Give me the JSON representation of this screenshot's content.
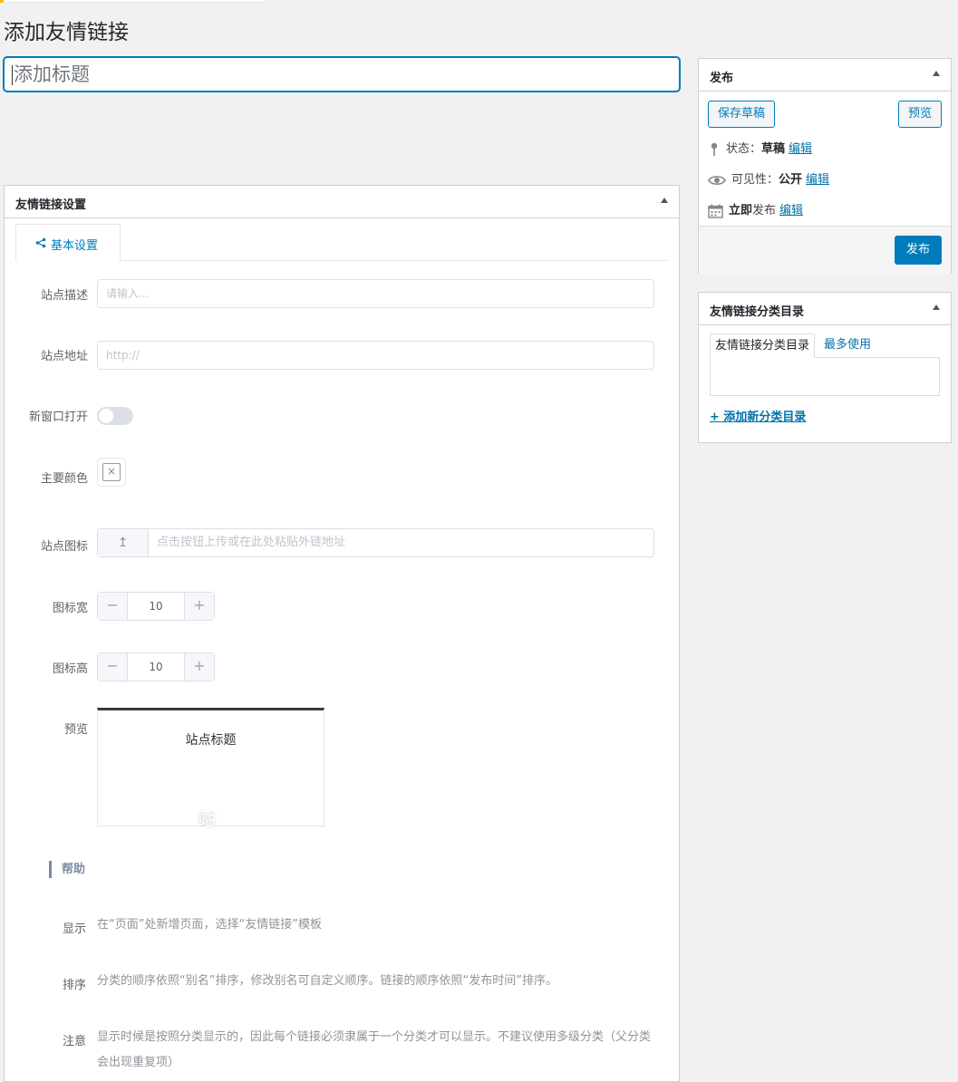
{
  "page": {
    "title": "添加友情链接",
    "title_placeholder": "添加标题"
  },
  "metabox": {
    "title": "友情链接设置",
    "tab_label": "基本设置",
    "fields": {
      "description_label": "站点描述",
      "description_placeholder": "请输入...",
      "url_label": "站点地址",
      "url_placeholder": "http://",
      "new_window_label": "新窗口打开",
      "new_window_on": false,
      "color_label": "主要颜色",
      "icon_label": "站点图标",
      "icon_placeholder": "点击按钮上传或在此处粘贴外链地址",
      "icon_width_label": "图标宽",
      "icon_width_value": "10",
      "icon_height_label": "图标高",
      "icon_height_value": "10",
      "preview_label": "预览",
      "preview_title": "站点标题",
      "preview_icon_char": "站"
    },
    "help": {
      "heading": "帮助",
      "items": [
        {
          "label": "显示",
          "text": "在“页面”处新增页面，选择“友情链接”模板"
        },
        {
          "label": "排序",
          "text": "分类的顺序依照“别名”排序，修改别名可自定义顺序。链接的顺序依照“发布时间”排序。"
        },
        {
          "label": "注意",
          "text": "显示时候是按照分类显示的，因此每个链接必须隶属于一个分类才可以显示。不建议使用多级分类（父分类会出现重复项）"
        }
      ]
    }
  },
  "publish": {
    "title": "发布",
    "save_draft": "保存草稿",
    "preview": "预览",
    "status_label": "状态：",
    "status_value": "草稿",
    "visibility_label": "可见性：",
    "visibility_value": "公开",
    "schedule_bold": "立即",
    "schedule_rest": "发布",
    "edit": "编辑",
    "publish_button": "发布"
  },
  "category": {
    "title": "友情链接分类目录",
    "tab_all": "友情链接分类目录",
    "tab_popular": "最多使用",
    "add_new": "+ 添加新分类目录"
  },
  "colors": {
    "accent": "#007cba",
    "link": "#0073aa"
  }
}
